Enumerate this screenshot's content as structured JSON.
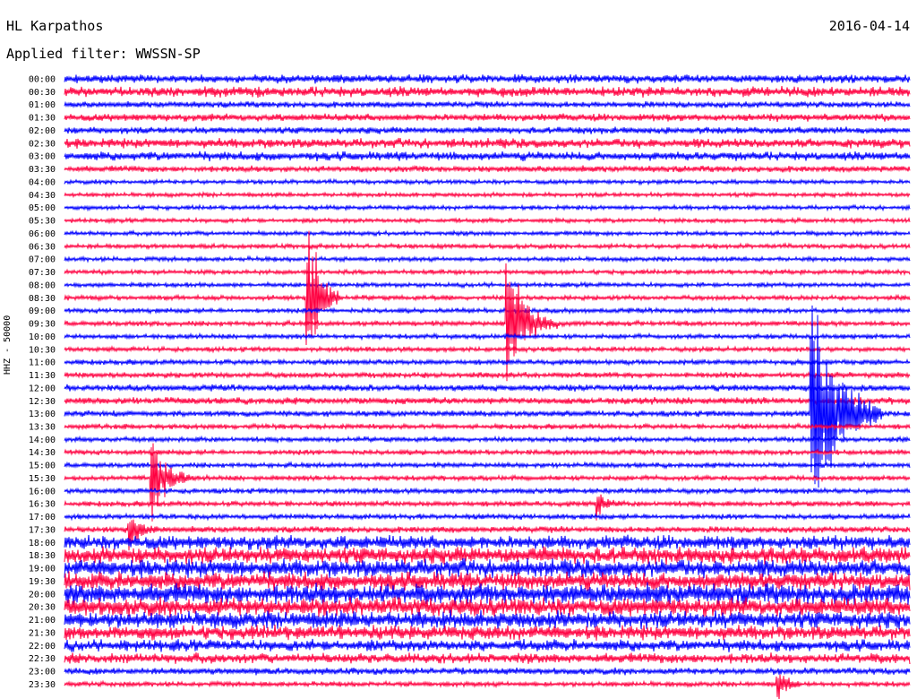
{
  "header": {
    "station": "HL Karpathos",
    "date": "2016-04-14",
    "filter": "Applied filter: WWSSN-SP"
  },
  "chart_data": {
    "type": "line",
    "title": "HL Karpathos",
    "date": "2016-04-14",
    "filter": "WWSSN-SP",
    "ylabel": "HHZ - 50000",
    "colors": [
      "#0000ff",
      "#ff0040"
    ],
    "times": [
      "00:00",
      "00:30",
      "01:00",
      "01:30",
      "02:00",
      "02:30",
      "03:00",
      "03:30",
      "04:00",
      "04:30",
      "05:00",
      "05:30",
      "06:00",
      "06:30",
      "07:00",
      "07:30",
      "08:00",
      "08:30",
      "09:00",
      "09:30",
      "10:00",
      "10:30",
      "11:00",
      "11:30",
      "12:00",
      "12:30",
      "13:00",
      "13:30",
      "14:00",
      "14:30",
      "15:00",
      "15:30",
      "16:00",
      "16:30",
      "17:00",
      "17:30",
      "18:00",
      "18:30",
      "19:00",
      "19:30",
      "20:00",
      "20:30",
      "21:00",
      "21:30",
      "22:00",
      "22:30",
      "23:00",
      "23:30"
    ],
    "noise_level": [
      0.22,
      0.3,
      0.12,
      0.18,
      0.15,
      0.26,
      0.24,
      0.13,
      0.05,
      0.05,
      0.05,
      0.05,
      0.06,
      0.06,
      0.06,
      0.06,
      0.06,
      0.07,
      0.07,
      0.08,
      0.07,
      0.07,
      0.09,
      0.1,
      0.14,
      0.16,
      0.12,
      0.08,
      0.08,
      0.08,
      0.08,
      0.08,
      0.09,
      0.09,
      0.09,
      0.12,
      0.45,
      0.55,
      0.6,
      0.6,
      0.7,
      0.62,
      0.58,
      0.45,
      0.35,
      0.3,
      0.15,
      0.08
    ],
    "events": [
      {
        "trace": "08:30",
        "minute": 8.6,
        "amplitude": 120,
        "duration": 1.2
      },
      {
        "trace": "09:30",
        "minute": 15.7,
        "amplitude": 90,
        "duration": 1.8
      },
      {
        "trace": "15:30",
        "minute": 3.1,
        "amplitude": 60,
        "duration": 1.4
      },
      {
        "trace": "13:00",
        "minute": 26.5,
        "amplitude": 170,
        "duration": 2.5
      },
      {
        "trace": "17:30",
        "minute": 2.3,
        "amplitude": 25,
        "duration": 1.0
      },
      {
        "trace": "16:30",
        "minute": 18.9,
        "amplitude": 20,
        "duration": 0.8
      },
      {
        "trace": "23:30",
        "minute": 25.3,
        "amplitude": 25,
        "duration": 0.8
      }
    ]
  }
}
